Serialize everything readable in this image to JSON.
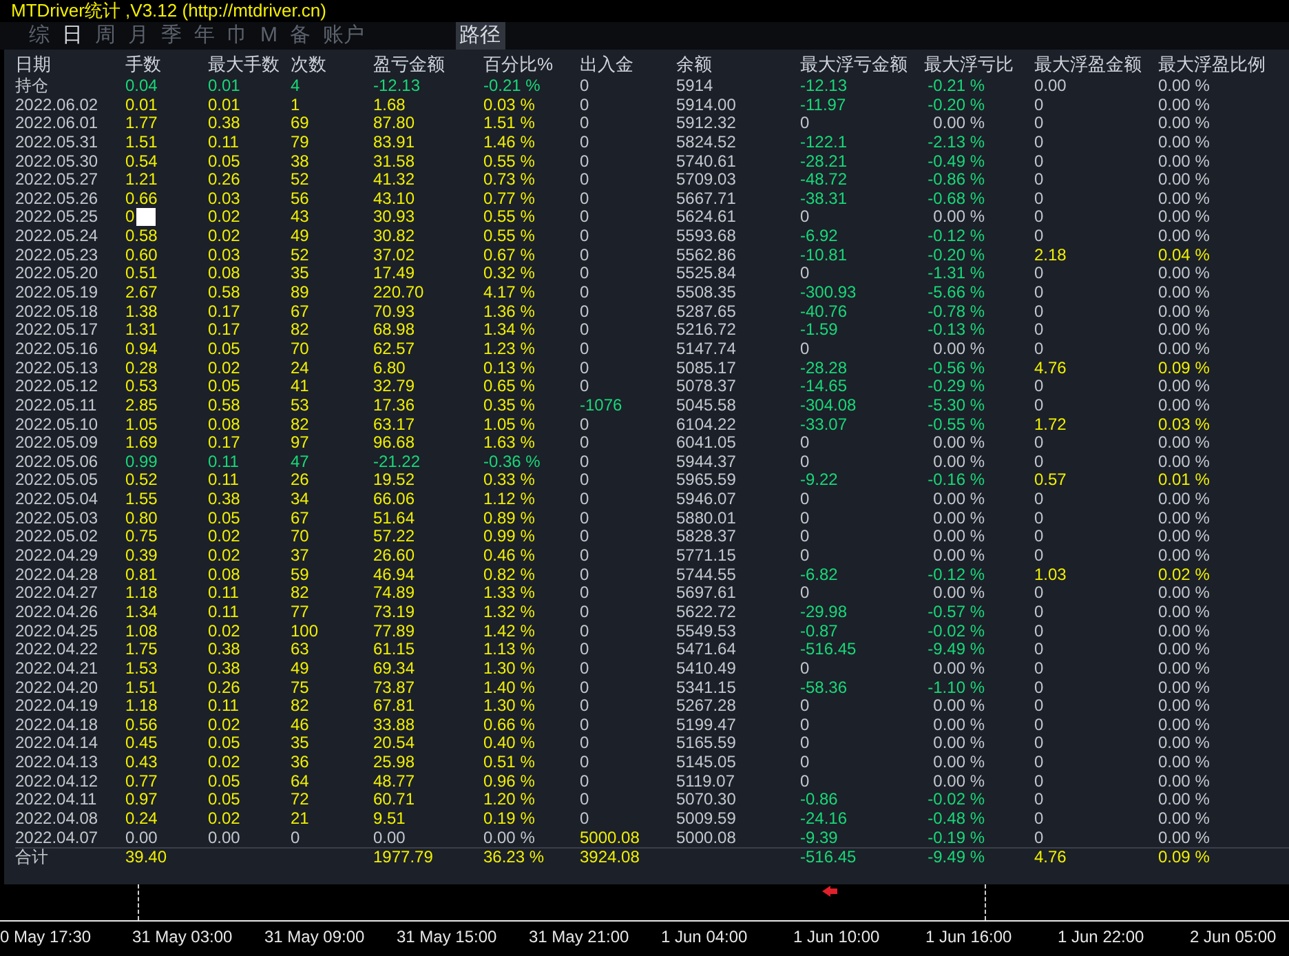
{
  "title": "MTDriver统计 ,V3.12 (http://mtdriver.cn)",
  "tabs": [
    {
      "label": "综",
      "selected": false
    },
    {
      "label": "日",
      "selected": true
    },
    {
      "label": "周",
      "selected": false
    },
    {
      "label": "月",
      "selected": false
    },
    {
      "label": "季",
      "selected": false
    },
    {
      "label": "年",
      "selected": false
    },
    {
      "label": "巾",
      "selected": false
    },
    {
      "label": "M",
      "selected": false
    },
    {
      "label": "备",
      "selected": false
    },
    {
      "label": "账户",
      "selected": false
    }
  ],
  "path_button": "路径",
  "table": {
    "columns": [
      "日期",
      "手数",
      "最大手数",
      "次数",
      "盈亏金额",
      "百分比%",
      "出入金",
      "余额",
      "最大浮亏金额",
      "最大浮亏比",
      "最大浮盈金额",
      "最大浮盈比例"
    ],
    "rows": [
      {
        "kind": "holding",
        "covered": false,
        "cells": [
          "持仓",
          "0.04",
          "0.01",
          "4",
          "-12.13",
          "-0.21 %",
          "0",
          "5914",
          "-12.13",
          "-0.21 %",
          "0.00",
          "0.00 %"
        ]
      },
      {
        "kind": "day",
        "covered": false,
        "cells": [
          "2022.06.02",
          "0.01",
          "0.01",
          "1",
          "1.68",
          "0.03 %",
          "0",
          "5914.00",
          "-11.97",
          "-0.20 %",
          "0",
          "0.00 %"
        ]
      },
      {
        "kind": "day",
        "covered": false,
        "cells": [
          "2022.06.01",
          "1.77",
          "0.38",
          "69",
          "87.80",
          "1.51 %",
          "0",
          "5912.32",
          "0",
          "0.00 %",
          "0",
          "0.00 %"
        ]
      },
      {
        "kind": "day",
        "covered": false,
        "cells": [
          "2022.05.31",
          "1.51",
          "0.11",
          "79",
          "83.91",
          "1.46 %",
          "0",
          "5824.52",
          "-122.1",
          "-2.13 %",
          "0",
          "0.00 %"
        ]
      },
      {
        "kind": "day",
        "covered": false,
        "cells": [
          "2022.05.30",
          "0.54",
          "0.05",
          "38",
          "31.58",
          "0.55 %",
          "0",
          "5740.61",
          "-28.21",
          "-0.49 %",
          "0",
          "0.00 %"
        ]
      },
      {
        "kind": "day",
        "covered": false,
        "cells": [
          "2022.05.27",
          "1.21",
          "0.26",
          "52",
          "41.32",
          "0.73 %",
          "0",
          "5709.03",
          "-48.72",
          "-0.86 %",
          "0",
          "0.00 %"
        ]
      },
      {
        "kind": "day",
        "covered": false,
        "cells": [
          "2022.05.26",
          "0.66",
          "0.03",
          "56",
          "43.10",
          "0.77 %",
          "0",
          "5667.71",
          "-38.31",
          "-0.68 %",
          "0",
          "0.00 %"
        ]
      },
      {
        "kind": "day",
        "covered": true,
        "cells": [
          "2022.05.25",
          "0",
          "0.02",
          "43",
          "30.93",
          "0.55 %",
          "0",
          "5624.61",
          "0",
          "0.00 %",
          "0",
          "0.00 %"
        ]
      },
      {
        "kind": "day",
        "covered": false,
        "cells": [
          "2022.05.24",
          "0.58",
          "0.02",
          "49",
          "30.82",
          "0.55 %",
          "0",
          "5593.68",
          "-6.92",
          "-0.12 %",
          "0",
          "0.00 %"
        ]
      },
      {
        "kind": "day",
        "covered": false,
        "cells": [
          "2022.05.23",
          "0.60",
          "0.03",
          "52",
          "37.02",
          "0.67 %",
          "0",
          "5562.86",
          "-10.81",
          "-0.20 %",
          "2.18",
          "0.04 %"
        ]
      },
      {
        "kind": "day",
        "covered": false,
        "cells": [
          "2022.05.20",
          "0.51",
          "0.08",
          "35",
          "17.49",
          "0.32 %",
          "0",
          "5525.84",
          "0",
          "-1.31 %",
          "0",
          "0.00 %"
        ]
      },
      {
        "kind": "day",
        "covered": false,
        "cells": [
          "2022.05.19",
          "2.67",
          "0.58",
          "89",
          "220.70",
          "4.17 %",
          "0",
          "5508.35",
          "-300.93",
          "-5.66 %",
          "0",
          "0.00 %"
        ]
      },
      {
        "kind": "day",
        "covered": false,
        "cells": [
          "2022.05.18",
          "1.38",
          "0.17",
          "67",
          "70.93",
          "1.36 %",
          "0",
          "5287.65",
          "-40.76",
          "-0.78 %",
          "0",
          "0.00 %"
        ]
      },
      {
        "kind": "day",
        "covered": false,
        "cells": [
          "2022.05.17",
          "1.31",
          "0.17",
          "82",
          "68.98",
          "1.34 %",
          "0",
          "5216.72",
          "-1.59",
          "-0.13 %",
          "0",
          "0.00 %"
        ]
      },
      {
        "kind": "day",
        "covered": false,
        "cells": [
          "2022.05.16",
          "0.94",
          "0.05",
          "70",
          "62.57",
          "1.23 %",
          "0",
          "5147.74",
          "0",
          "0.00 %",
          "0",
          "0.00 %"
        ]
      },
      {
        "kind": "day",
        "covered": false,
        "cells": [
          "2022.05.13",
          "0.28",
          "0.02",
          "24",
          "6.80",
          "0.13 %",
          "0",
          "5085.17",
          "-28.28",
          "-0.56 %",
          "4.76",
          "0.09 %"
        ]
      },
      {
        "kind": "day",
        "covered": false,
        "cells": [
          "2022.05.12",
          "0.53",
          "0.05",
          "41",
          "32.79",
          "0.65 %",
          "0",
          "5078.37",
          "-14.65",
          "-0.29 %",
          "0",
          "0.00 %"
        ]
      },
      {
        "kind": "day",
        "covered": false,
        "cells": [
          "2022.05.11",
          "2.85",
          "0.58",
          "53",
          "17.36",
          "0.35 %",
          "-1076",
          "5045.58",
          "-304.08",
          "-5.30 %",
          "0",
          "0.00 %"
        ]
      },
      {
        "kind": "day",
        "covered": false,
        "cells": [
          "2022.05.10",
          "1.05",
          "0.08",
          "82",
          "63.17",
          "1.05 %",
          "0",
          "6104.22",
          "-33.07",
          "-0.55 %",
          "1.72",
          "0.03 %"
        ]
      },
      {
        "kind": "day",
        "covered": false,
        "cells": [
          "2022.05.09",
          "1.69",
          "0.17",
          "97",
          "96.68",
          "1.63 %",
          "0",
          "6041.05",
          "0",
          "0.00 %",
          "0",
          "0.00 %"
        ]
      },
      {
        "kind": "day",
        "covered": false,
        "cells": [
          "2022.05.06",
          "0.99",
          "0.11",
          "47",
          "-21.22",
          "-0.36 %",
          "0",
          "5944.37",
          "0",
          "0.00 %",
          "0",
          "0.00 %"
        ]
      },
      {
        "kind": "day",
        "covered": false,
        "cells": [
          "2022.05.05",
          "0.52",
          "0.11",
          "26",
          "19.52",
          "0.33 %",
          "0",
          "5965.59",
          "-9.22",
          "-0.16 %",
          "0.57",
          "0.01 %"
        ]
      },
      {
        "kind": "day",
        "covered": false,
        "cells": [
          "2022.05.04",
          "1.55",
          "0.38",
          "34",
          "66.06",
          "1.12 %",
          "0",
          "5946.07",
          "0",
          "0.00 %",
          "0",
          "0.00 %"
        ]
      },
      {
        "kind": "day",
        "covered": false,
        "cells": [
          "2022.05.03",
          "0.80",
          "0.05",
          "67",
          "51.64",
          "0.89 %",
          "0",
          "5880.01",
          "0",
          "0.00 %",
          "0",
          "0.00 %"
        ]
      },
      {
        "kind": "day",
        "covered": false,
        "cells": [
          "2022.05.02",
          "0.75",
          "0.02",
          "70",
          "57.22",
          "0.99 %",
          "0",
          "5828.37",
          "0",
          "0.00 %",
          "0",
          "0.00 %"
        ]
      },
      {
        "kind": "day",
        "covered": false,
        "cells": [
          "2022.04.29",
          "0.39",
          "0.02",
          "37",
          "26.60",
          "0.46 %",
          "0",
          "5771.15",
          "0",
          "0.00 %",
          "0",
          "0.00 %"
        ]
      },
      {
        "kind": "day",
        "covered": false,
        "cells": [
          "2022.04.28",
          "0.81",
          "0.08",
          "59",
          "46.94",
          "0.82 %",
          "0",
          "5744.55",
          "-6.82",
          "-0.12 %",
          "1.03",
          "0.02 %"
        ]
      },
      {
        "kind": "day",
        "covered": false,
        "cells": [
          "2022.04.27",
          "1.18",
          "0.11",
          "82",
          "74.89",
          "1.33 %",
          "0",
          "5697.61",
          "0",
          "0.00 %",
          "0",
          "0.00 %"
        ]
      },
      {
        "kind": "day",
        "covered": false,
        "cells": [
          "2022.04.26",
          "1.34",
          "0.11",
          "77",
          "73.19",
          "1.32 %",
          "0",
          "5622.72",
          "-29.98",
          "-0.57 %",
          "0",
          "0.00 %"
        ]
      },
      {
        "kind": "day",
        "covered": false,
        "cells": [
          "2022.04.25",
          "1.08",
          "0.02",
          "100",
          "77.89",
          "1.42 %",
          "0",
          "5549.53",
          "-0.87",
          "-0.02 %",
          "0",
          "0.00 %"
        ]
      },
      {
        "kind": "day",
        "covered": false,
        "cells": [
          "2022.04.22",
          "1.75",
          "0.38",
          "63",
          "61.15",
          "1.13 %",
          "0",
          "5471.64",
          "-516.45",
          "-9.49 %",
          "0",
          "0.00 %"
        ]
      },
      {
        "kind": "day",
        "covered": false,
        "cells": [
          "2022.04.21",
          "1.53",
          "0.38",
          "49",
          "69.34",
          "1.30 %",
          "0",
          "5410.49",
          "0",
          "0.00 %",
          "0",
          "0.00 %"
        ]
      },
      {
        "kind": "day",
        "covered": false,
        "cells": [
          "2022.04.20",
          "1.51",
          "0.26",
          "75",
          "73.87",
          "1.40 %",
          "0",
          "5341.15",
          "-58.36",
          "-1.10 %",
          "0",
          "0.00 %"
        ]
      },
      {
        "kind": "day",
        "covered": false,
        "cells": [
          "2022.04.19",
          "1.18",
          "0.11",
          "82",
          "67.81",
          "1.30 %",
          "0",
          "5267.28",
          "0",
          "0.00 %",
          "0",
          "0.00 %"
        ]
      },
      {
        "kind": "day",
        "covered": false,
        "cells": [
          "2022.04.18",
          "0.56",
          "0.02",
          "46",
          "33.88",
          "0.66 %",
          "0",
          "5199.47",
          "0",
          "0.00 %",
          "0",
          "0.00 %"
        ]
      },
      {
        "kind": "day",
        "covered": false,
        "cells": [
          "2022.04.14",
          "0.45",
          "0.05",
          "35",
          "20.54",
          "0.40 %",
          "0",
          "5165.59",
          "0",
          "0.00 %",
          "0",
          "0.00 %"
        ]
      },
      {
        "kind": "day",
        "covered": false,
        "cells": [
          "2022.04.13",
          "0.43",
          "0.02",
          "36",
          "25.98",
          "0.51 %",
          "0",
          "5145.05",
          "0",
          "0.00 %",
          "0",
          "0.00 %"
        ]
      },
      {
        "kind": "day",
        "covered": false,
        "cells": [
          "2022.04.12",
          "0.77",
          "0.05",
          "64",
          "48.77",
          "0.96 %",
          "0",
          "5119.07",
          "0",
          "0.00 %",
          "0",
          "0.00 %"
        ]
      },
      {
        "kind": "day",
        "covered": false,
        "cells": [
          "2022.04.11",
          "0.97",
          "0.05",
          "72",
          "60.71",
          "1.20 %",
          "0",
          "5070.30",
          "-0.86",
          "-0.02 %",
          "0",
          "0.00 %"
        ]
      },
      {
        "kind": "day",
        "covered": false,
        "cells": [
          "2022.04.08",
          "0.24",
          "0.02",
          "21",
          "9.51",
          "0.19 %",
          "0",
          "5009.59",
          "-24.16",
          "-0.48 %",
          "0",
          "0.00 %"
        ]
      },
      {
        "kind": "day",
        "covered": false,
        "cells": [
          "2022.04.07",
          "0.00",
          "0.00",
          "0",
          "0.00",
          "0.00 %",
          "5000.08",
          "5000.08",
          "-9.39",
          "-0.19 %",
          "0",
          "0.00 %"
        ]
      },
      {
        "kind": "total",
        "covered": false,
        "cells": [
          "合计",
          "39.40",
          "",
          "",
          "1977.79",
          "36.23 %",
          "3924.08",
          "",
          "-516.45",
          "-9.49 %",
          "4.76",
          "0.09 %"
        ]
      }
    ]
  },
  "time_axis": {
    "labels": [
      "0 May 17:30",
      "31 May 03:00",
      "31 May 09:00",
      "31 May 15:00",
      "31 May 21:00",
      "1 Jun 04:00",
      "1 Jun 10:00",
      "1 Jun 16:00",
      "1 Jun 22:00",
      "2 Jun 05:00"
    ]
  }
}
